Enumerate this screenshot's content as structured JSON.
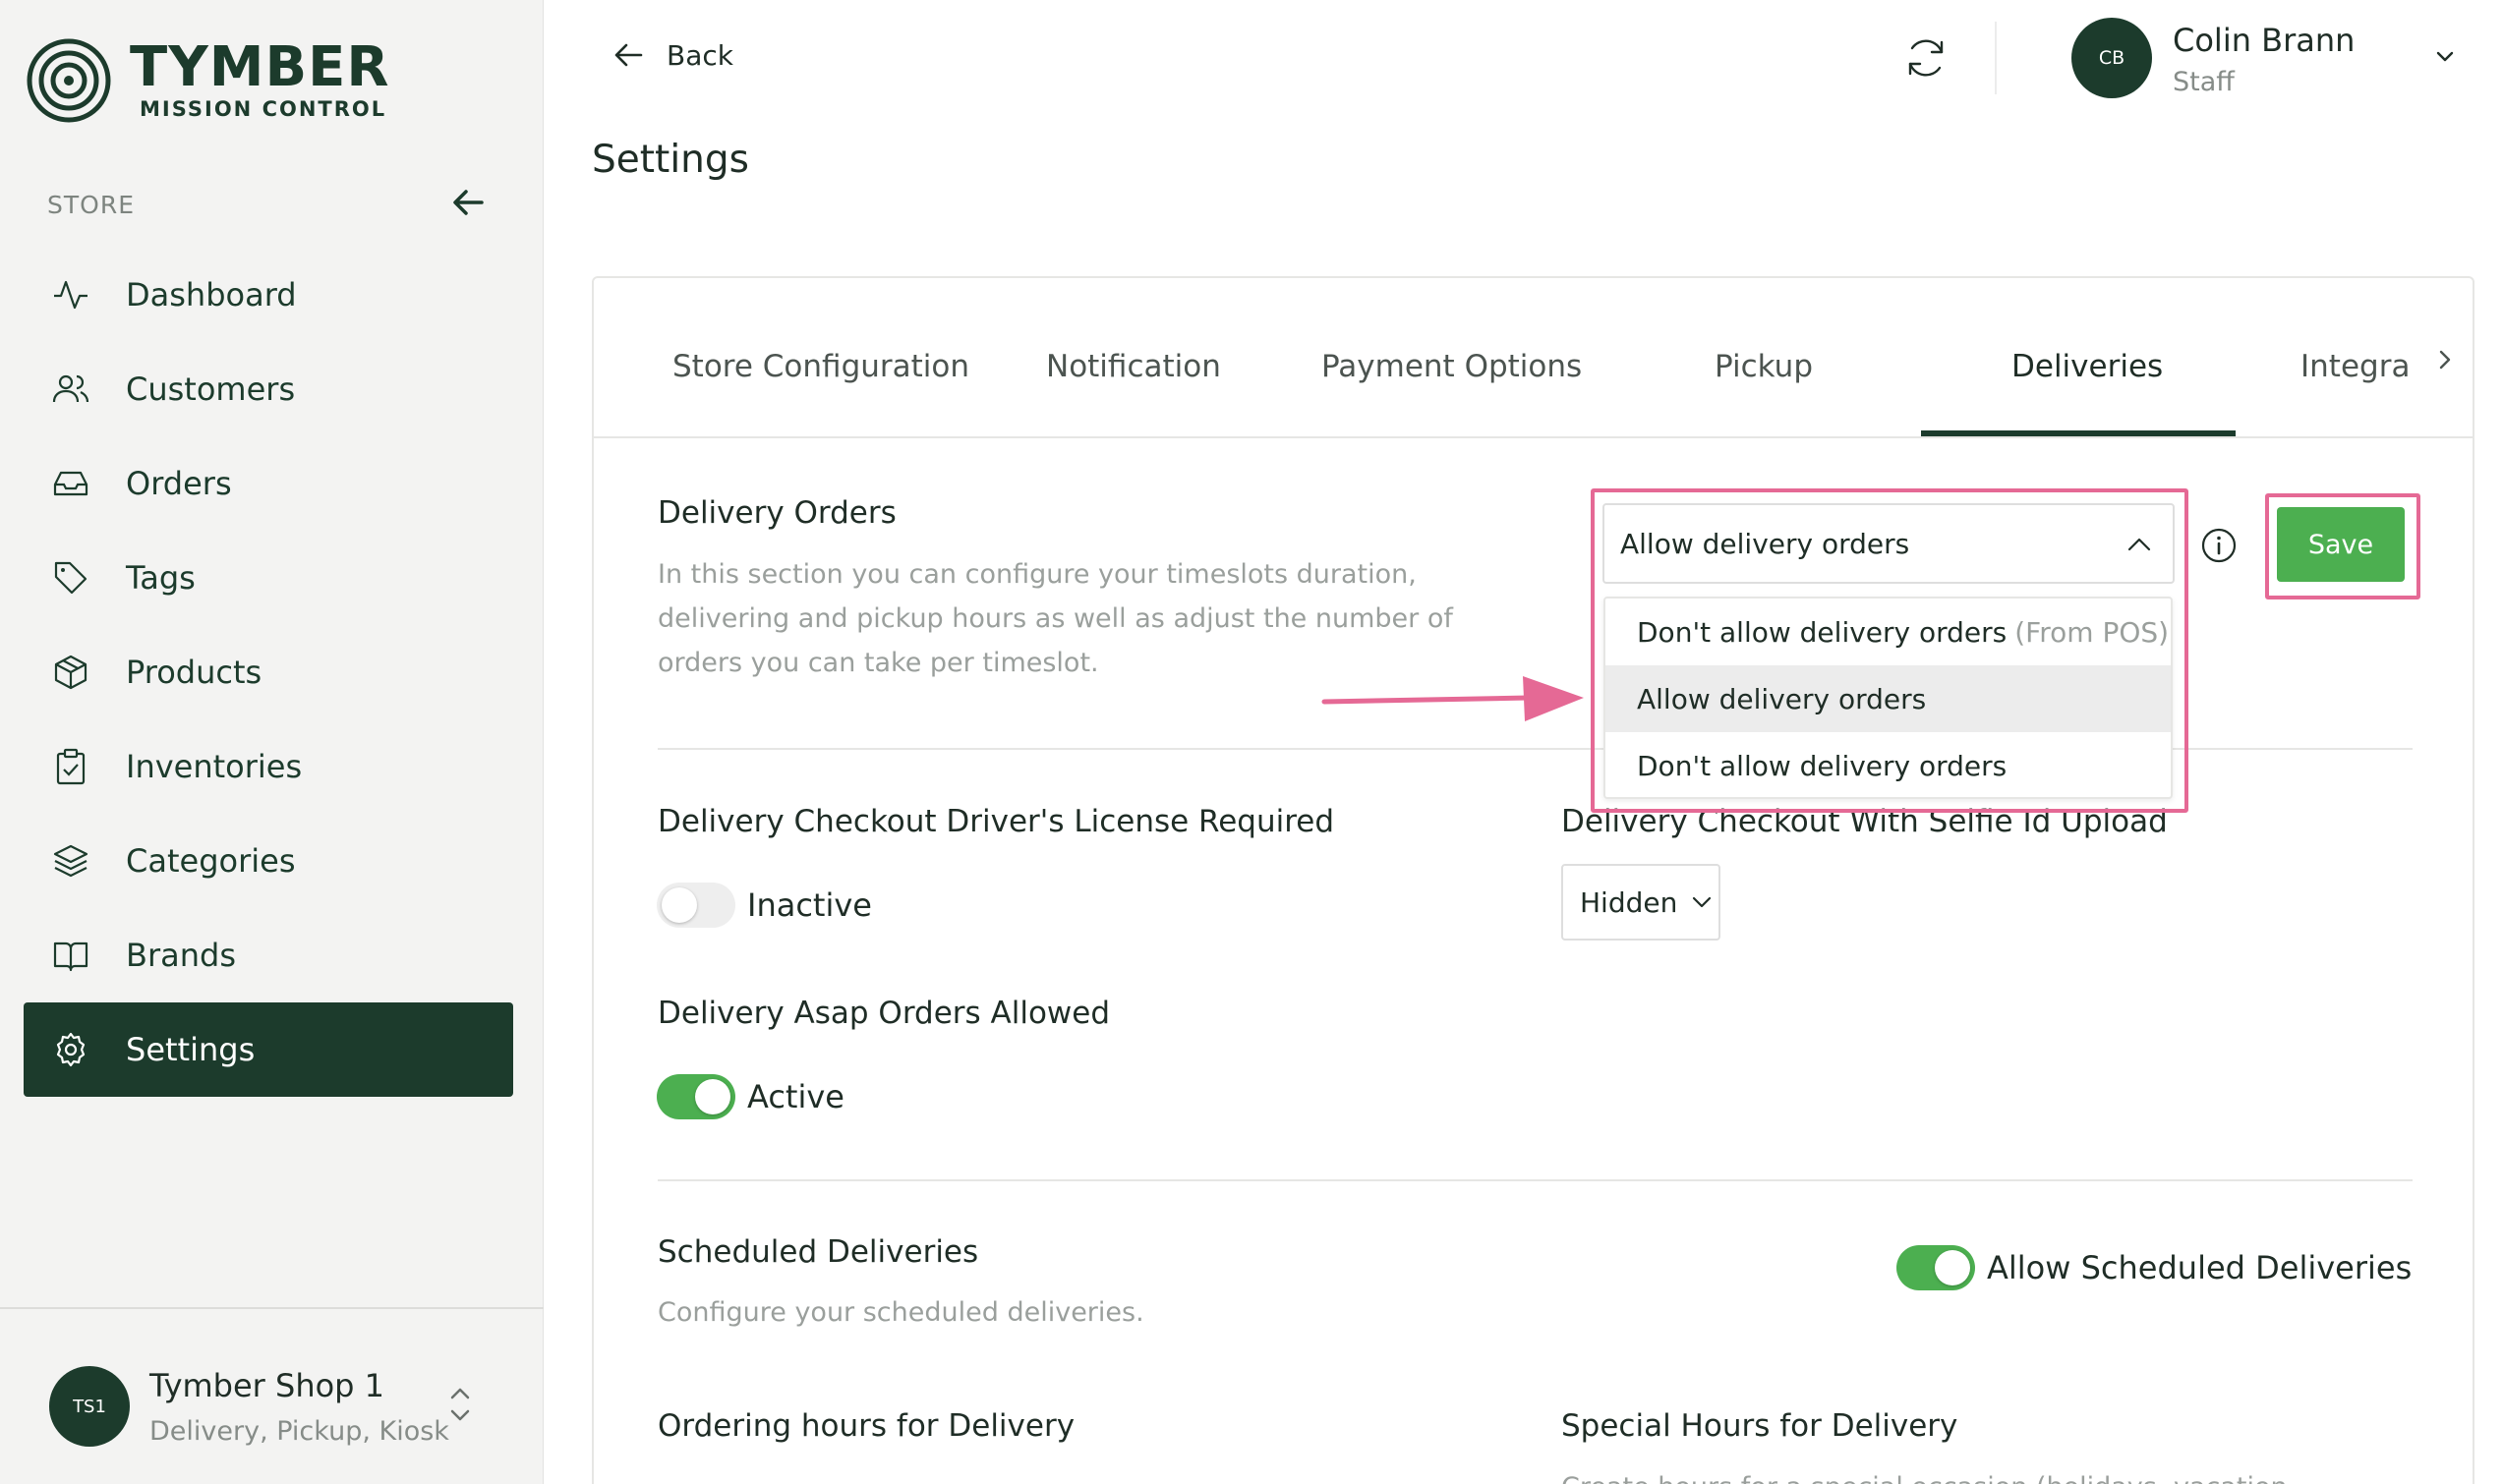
{
  "brand": {
    "name": "TYMBER",
    "subtitle": "MISSION CONTROL"
  },
  "sidebar": {
    "section_label": "STORE",
    "items": [
      {
        "label": "Dashboard",
        "icon": "activity-icon"
      },
      {
        "label": "Customers",
        "icon": "users-icon"
      },
      {
        "label": "Orders",
        "icon": "inbox-icon"
      },
      {
        "label": "Tags",
        "icon": "tag-icon"
      },
      {
        "label": "Products",
        "icon": "box-icon"
      },
      {
        "label": "Inventories",
        "icon": "clipboard-icon"
      },
      {
        "label": "Categories",
        "icon": "layers-icon"
      },
      {
        "label": "Brands",
        "icon": "book-icon"
      },
      {
        "label": "Settings",
        "icon": "gear-icon",
        "active": true
      }
    ],
    "shop": {
      "avatar": "TS1",
      "name": "Tymber Shop 1",
      "types": "Delivery, Pickup, Kiosk"
    }
  },
  "topbar": {
    "back_label": "Back",
    "user": {
      "initials": "CB",
      "name": "Colin Brann",
      "role": "Staff"
    }
  },
  "page_title": "Settings",
  "tabs": [
    {
      "label": "Store Configuration"
    },
    {
      "label": "Notification"
    },
    {
      "label": "Payment Options"
    },
    {
      "label": "Pickup"
    },
    {
      "label": "Deliveries",
      "active": true
    },
    {
      "label": "Integra"
    }
  ],
  "delivery_orders": {
    "title": "Delivery Orders",
    "description": [
      "In this section you can configure your timeslots duration,",
      "delivering and pickup hours as well as adjust the number of",
      "orders you can take per timeslot."
    ],
    "selected": "Allow delivery orders",
    "options": [
      {
        "label": "Don't allow delivery orders",
        "suffix": "(From POS)"
      },
      {
        "label": "Allow delivery orders",
        "selected": true
      },
      {
        "label": "Don't allow delivery orders"
      }
    ],
    "save_label": "Save"
  },
  "license": {
    "title": "Delivery Checkout Driver's License Required",
    "state": "Inactive"
  },
  "selfie": {
    "title": "Delivery Checkout With Selfie Id Upload",
    "value": "Hidden"
  },
  "asap": {
    "title": "Delivery Asap Orders Allowed",
    "state": "Active"
  },
  "scheduled": {
    "title": "Scheduled Deliveries",
    "description": "Configure your scheduled deliveries.",
    "toggle_label": "Allow Scheduled Deliveries"
  },
  "ordering_hours": {
    "title": "Ordering hours for Delivery"
  },
  "special_hours": {
    "title": "Special Hours for Delivery",
    "description": "Create hours for a special occasion (holidays, vacation"
  },
  "colors": {
    "brand_dark": "#1c3b2c",
    "accent_green": "#4caf50",
    "annotation_pink": "#e56995"
  }
}
